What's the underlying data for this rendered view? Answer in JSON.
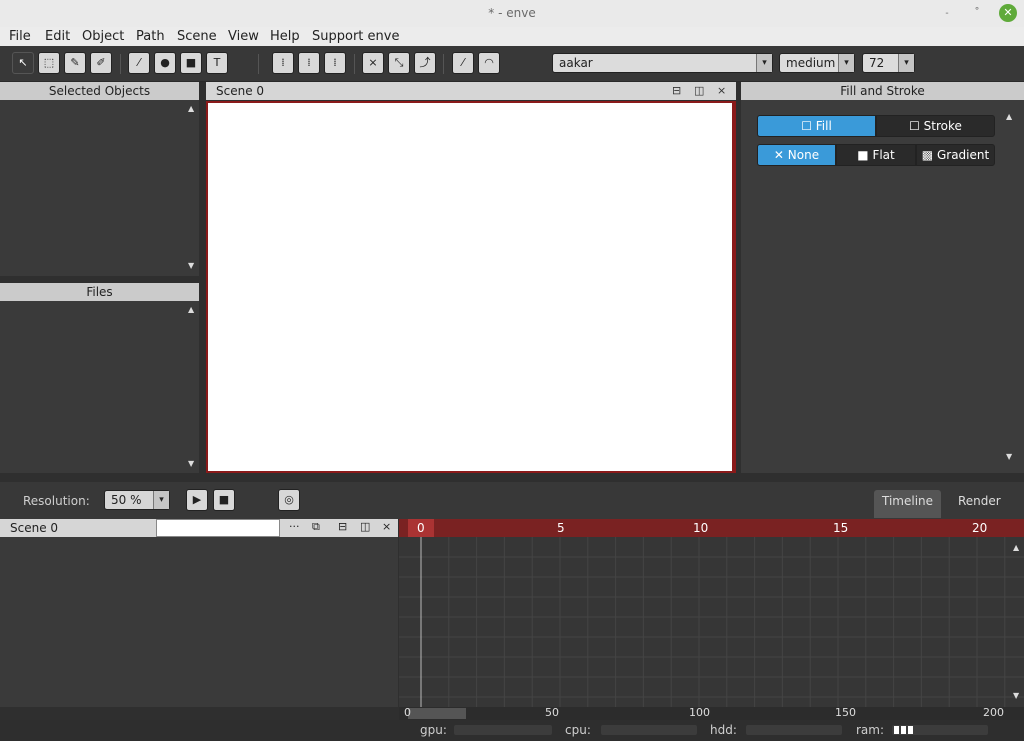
{
  "window": {
    "title": "* - enve",
    "minimize": "˗",
    "maximize": "˚",
    "close": "✕"
  },
  "menu": [
    "File",
    "Edit",
    "Object",
    "Path",
    "Scene",
    "View",
    "Help",
    "Support enve"
  ],
  "toolbar": {
    "font_family": "aakar",
    "font_weight": "medium",
    "font_size": "72",
    "arrow": "▾"
  },
  "panels": {
    "selected_objects": "Selected Objects",
    "files": "Files",
    "fill_and_stroke": "Fill and Stroke"
  },
  "scene_viewer": {
    "tab": "Scene 0",
    "ctl_split_h": "⊟",
    "ctl_split_v": "◫",
    "ctl_close": "×"
  },
  "fill_stroke": {
    "target_fill": "Fill",
    "target_stroke": "Stroke",
    "paint_none": "None",
    "paint_flat": "Flat",
    "paint_gradient": "Gradient",
    "active_target": "Fill",
    "active_paint": "None"
  },
  "lower_toolbar": {
    "resolution_label": "Resolution:",
    "resolution_value": "50 %",
    "tab_timeline": "Timeline",
    "tab_render": "Render"
  },
  "timeline": {
    "scene_label": "Scene 0",
    "search_value": "",
    "ctl_more": "···",
    "ctl_split_h": "⊟",
    "ctl_split_v": "◫",
    "ctl_close": "×",
    "frame_ticks": [
      "0",
      "5",
      "10",
      "15",
      "20"
    ],
    "bottom_ticks": [
      "0",
      "50",
      "100",
      "150",
      "200"
    ]
  },
  "status": {
    "gpu": "gpu:",
    "cpu": "cpu:",
    "hdd": "hdd:",
    "ram": "ram:"
  },
  "colors": {
    "accent": "#3a9ad9",
    "ruler": "#7a2222",
    "canvas_border": "#8a1a1a"
  }
}
